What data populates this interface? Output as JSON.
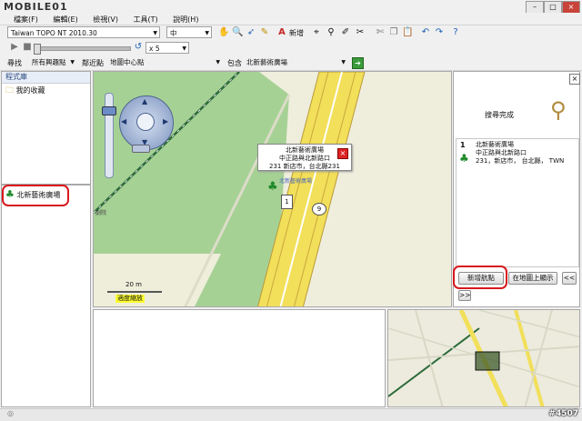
{
  "watermark": {
    "logo_text": "MOBILE01"
  },
  "menu": [
    "檔案(F)",
    "編輯(E)",
    "檢視(V)",
    "工具(T)",
    "說明(H)"
  ],
  "toolbar": {
    "map_product": "Taiwan TOPO NT 2010.30",
    "detail_level": "中",
    "new_label": "新增",
    "speed": "x 5"
  },
  "search_bar": {
    "find_label": "尋找",
    "category": "所有興趣點",
    "near_label": "鄰近點",
    "near_value": "地圖中心點",
    "contains_label": "包含",
    "query": "北新藝術廣場"
  },
  "library": {
    "header": "程式庫",
    "folder": "我的收藏"
  },
  "result_list": {
    "item": "北新藝術廣場"
  },
  "map": {
    "popup_title": "北新藝術廣場",
    "popup_line2": "中正路與北新路口",
    "popup_line3": "231 新店市，台北縣231",
    "marker_label": "北新藝術廣場",
    "route_shield": "9",
    "marker_number": "1",
    "map_text_left": "劇院",
    "scale": "20 m",
    "zoom_hint": "適度縮放"
  },
  "search_panel": {
    "status": "搜尋完成",
    "result_num": "1",
    "result_name": "北新藝術廣場",
    "result_addr": "中正路與北新路口",
    "result_city": "231，新店市， 台北縣， TWN",
    "new_route_btn": "新增航點",
    "show_on_map_btn": "在地圖上顯示",
    "prev_btn": "<<",
    "next_btn": ">>"
  },
  "footer": {
    "post_id": "#4507"
  },
  "colors": {
    "map_land": "#efeedd",
    "map_park": "#9fcf8f",
    "road_yellow": "#f5e45c",
    "highlight_red": "#d8191e",
    "route_green": "#2a8a2a"
  }
}
